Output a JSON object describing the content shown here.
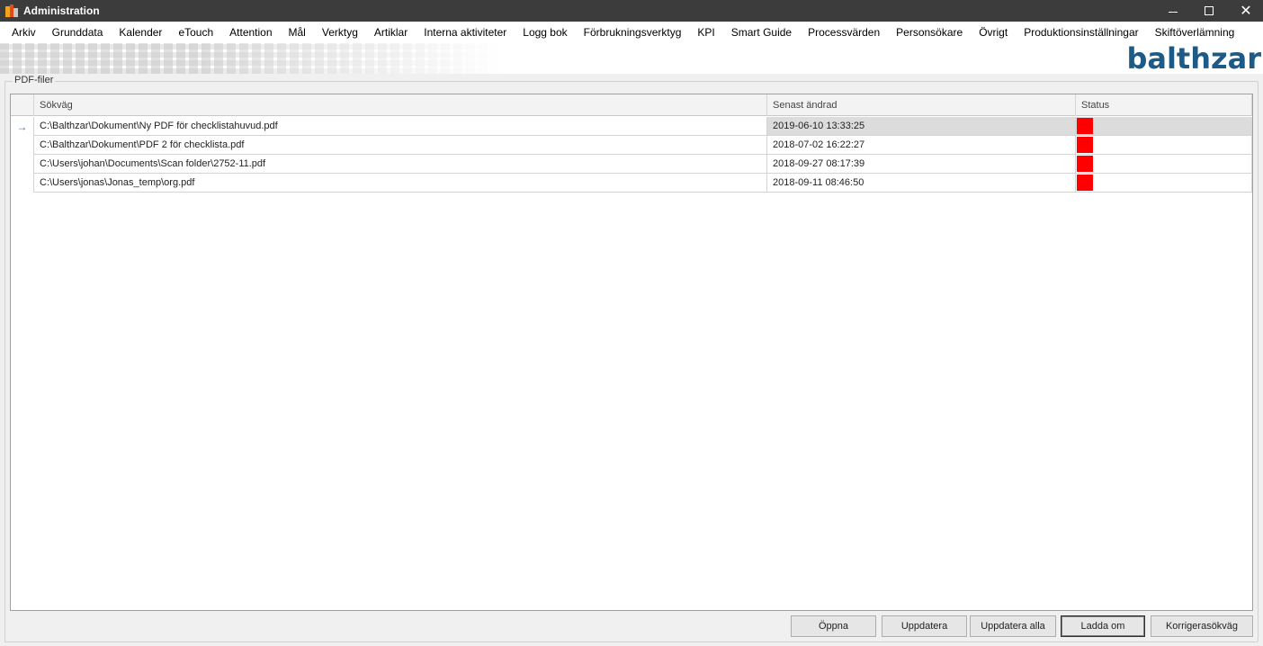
{
  "window": {
    "title": "Administration",
    "controls": {
      "minimize": "—",
      "maximize": "☐",
      "close": "✕"
    },
    "app_icon": "balthzar-app-icon"
  },
  "menu": {
    "items": [
      "Arkiv",
      "Grunddata",
      "Kalender",
      "eTouch",
      "Attention",
      "Mål",
      "Verktyg",
      "Artiklar",
      "Interna aktiviteter",
      "Logg bok",
      "Förbrukningsverktyg",
      "KPI",
      "Smart Guide",
      "Processvärden",
      "Personsökare",
      "Övrigt",
      "Produktionsinställningar",
      "Skiftöverlämning"
    ]
  },
  "banner": {
    "logo_text": "balthzar",
    "logo_color": "#1d5a86"
  },
  "group": {
    "legend": "PDF-filer"
  },
  "grid": {
    "columns": [
      "Sökväg",
      "Senast ändrad",
      "Status"
    ],
    "current_row_indicator": "→",
    "rows": [
      {
        "path": "C:\\Balthzar\\Dokument\\Ny PDF för checklistahuvud.pdf",
        "modified": "2019-06-10 13:33:25",
        "status_color": "#ff0000",
        "selected": true
      },
      {
        "path": "C:\\Balthzar\\Dokument\\PDF 2 för checklista.pdf",
        "modified": "2018-07-02 16:22:27",
        "status_color": "#ff0000",
        "selected": false
      },
      {
        "path": "C:\\Users\\johan\\Documents\\Scan folder\\2752-11.pdf",
        "modified": "2018-09-27 08:17:39",
        "status_color": "#ff0000",
        "selected": false
      },
      {
        "path": "C:\\Users\\jonas\\Jonas_temp\\org.pdf",
        "modified": "2018-09-11 08:46:50",
        "status_color": "#ff0000",
        "selected": false
      }
    ]
  },
  "buttons": {
    "open": "Öppna",
    "update": "Uppdatera",
    "update_all": "Uppdatera alla",
    "reload": "Ladda om",
    "correct_path": "Korrigerasökväg"
  }
}
